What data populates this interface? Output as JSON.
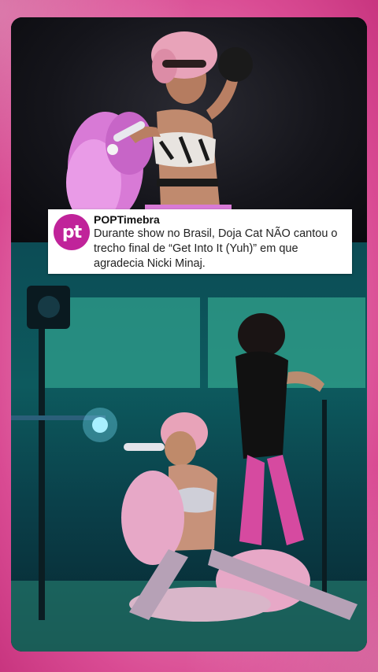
{
  "post": {
    "avatar_text": "pt",
    "account_name": "POPTimebra",
    "text": "Durante show no Brasil, Doja Cat NÃO cantou o trecho final de “Get Into It (Yuh)” em que agradecia Nicki Minaj."
  },
  "colors": {
    "frame_pink": "#d94b93",
    "avatar_magenta": "#c0239a",
    "stage_teal": "#0d5a5e"
  }
}
